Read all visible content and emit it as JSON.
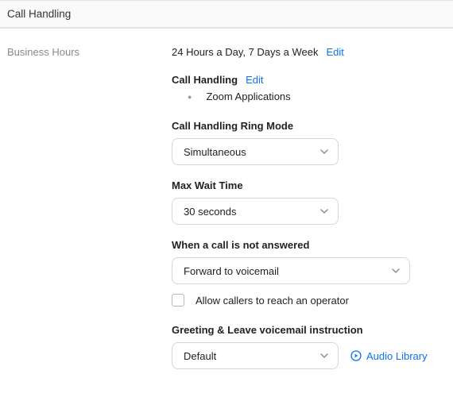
{
  "header": {
    "title": "Call Handling"
  },
  "left": {
    "business_hours_label": "Business Hours"
  },
  "right": {
    "business_hours_value": "24 Hours a Day, 7 Days a Week",
    "business_hours_edit": "Edit",
    "call_handling_label": "Call Handling",
    "call_handling_edit": "Edit",
    "bullet_items": [
      "Zoom Applications"
    ],
    "ring_mode": {
      "label": "Call Handling Ring Mode",
      "value": "Simultaneous"
    },
    "max_wait": {
      "label": "Max Wait Time",
      "value": "30 seconds"
    },
    "not_answered": {
      "label": "When a call is not answered",
      "value": "Forward to voicemail"
    },
    "allow_operator": {
      "label": "Allow callers to reach an operator",
      "checked": false
    },
    "greeting": {
      "label": "Greeting & Leave voicemail instruction",
      "value": "Default",
      "audio_library": "Audio Library"
    }
  }
}
